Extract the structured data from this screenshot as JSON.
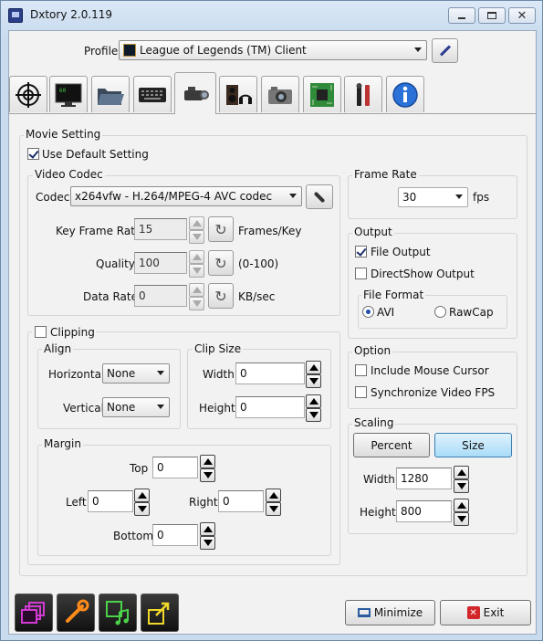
{
  "window": {
    "title": "Dxtory 2.0.119"
  },
  "profile": {
    "label": "Profile",
    "value": "League of Legends (TM) Client"
  },
  "tabs": [
    "crosshair",
    "monitor",
    "folder",
    "keyboard",
    "video-camera",
    "speaker-headphones",
    "photo-camera",
    "chip",
    "tools",
    "info"
  ],
  "movie": {
    "group_label": "Movie Setting",
    "use_default_label": "Use Default Setting",
    "use_default_checked": true,
    "video_codec": {
      "group_label": "Video Codec",
      "codec_label": "Codec",
      "codec_value": "x264vfw - H.264/MPEG-4 AVC codec",
      "keyframe_label": "Key Frame Rate",
      "keyframe_value": "15",
      "keyframe_unit": "Frames/Key",
      "quality_label": "Quality",
      "quality_value": "100",
      "quality_unit": "(0-100)",
      "datarate_label": "Data Rate",
      "datarate_value": "0",
      "datarate_unit": "KB/sec"
    },
    "clipping": {
      "label": "Clipping",
      "checked": false,
      "align_label": "Align",
      "horizontal_label": "Horizontal",
      "horizontal_value": "None",
      "vertical_label": "Vertical",
      "vertical_value": "None",
      "clipsize_label": "Clip Size",
      "width_label": "Width",
      "width_value": "0",
      "height_label": "Height",
      "height_value": "0",
      "margin_label": "Margin",
      "top_label": "Top",
      "top_value": "0",
      "left_label": "Left",
      "left_value": "0",
      "right_label": "Right",
      "right_value": "0",
      "bottom_label": "Bottom",
      "bottom_value": "0"
    },
    "frame_rate": {
      "label": "Frame Rate",
      "value": "30",
      "unit": "fps"
    },
    "output": {
      "label": "Output",
      "file_output_label": "File Output",
      "file_output_checked": true,
      "directshow_label": "DirectShow Output",
      "directshow_checked": false,
      "file_format_label": "File Format",
      "avi_label": "AVI",
      "rawcap_label": "RawCap",
      "selected": "AVI"
    },
    "option": {
      "label": "Option",
      "mouse_label": "Include Mouse Cursor",
      "mouse_checked": false,
      "sync_label": "Synchronize Video FPS",
      "sync_checked": false
    },
    "scaling": {
      "label": "Scaling",
      "percent_label": "Percent",
      "size_label": "Size",
      "selected": "Size",
      "width_label": "Width",
      "width_value": "1280",
      "height_label": "Height",
      "height_value": "800"
    }
  },
  "footer": {
    "minimize_label": "Minimize",
    "exit_label": "Exit"
  },
  "colors": {
    "selected_button": "#a9dcf8",
    "window_frame": "#c8dbef",
    "footer_icon_magenta": "#d23ad3",
    "footer_icon_orange": "#ff8c1a",
    "footer_icon_green": "#4cd14a",
    "footer_icon_yellow": "#f0d82a"
  }
}
